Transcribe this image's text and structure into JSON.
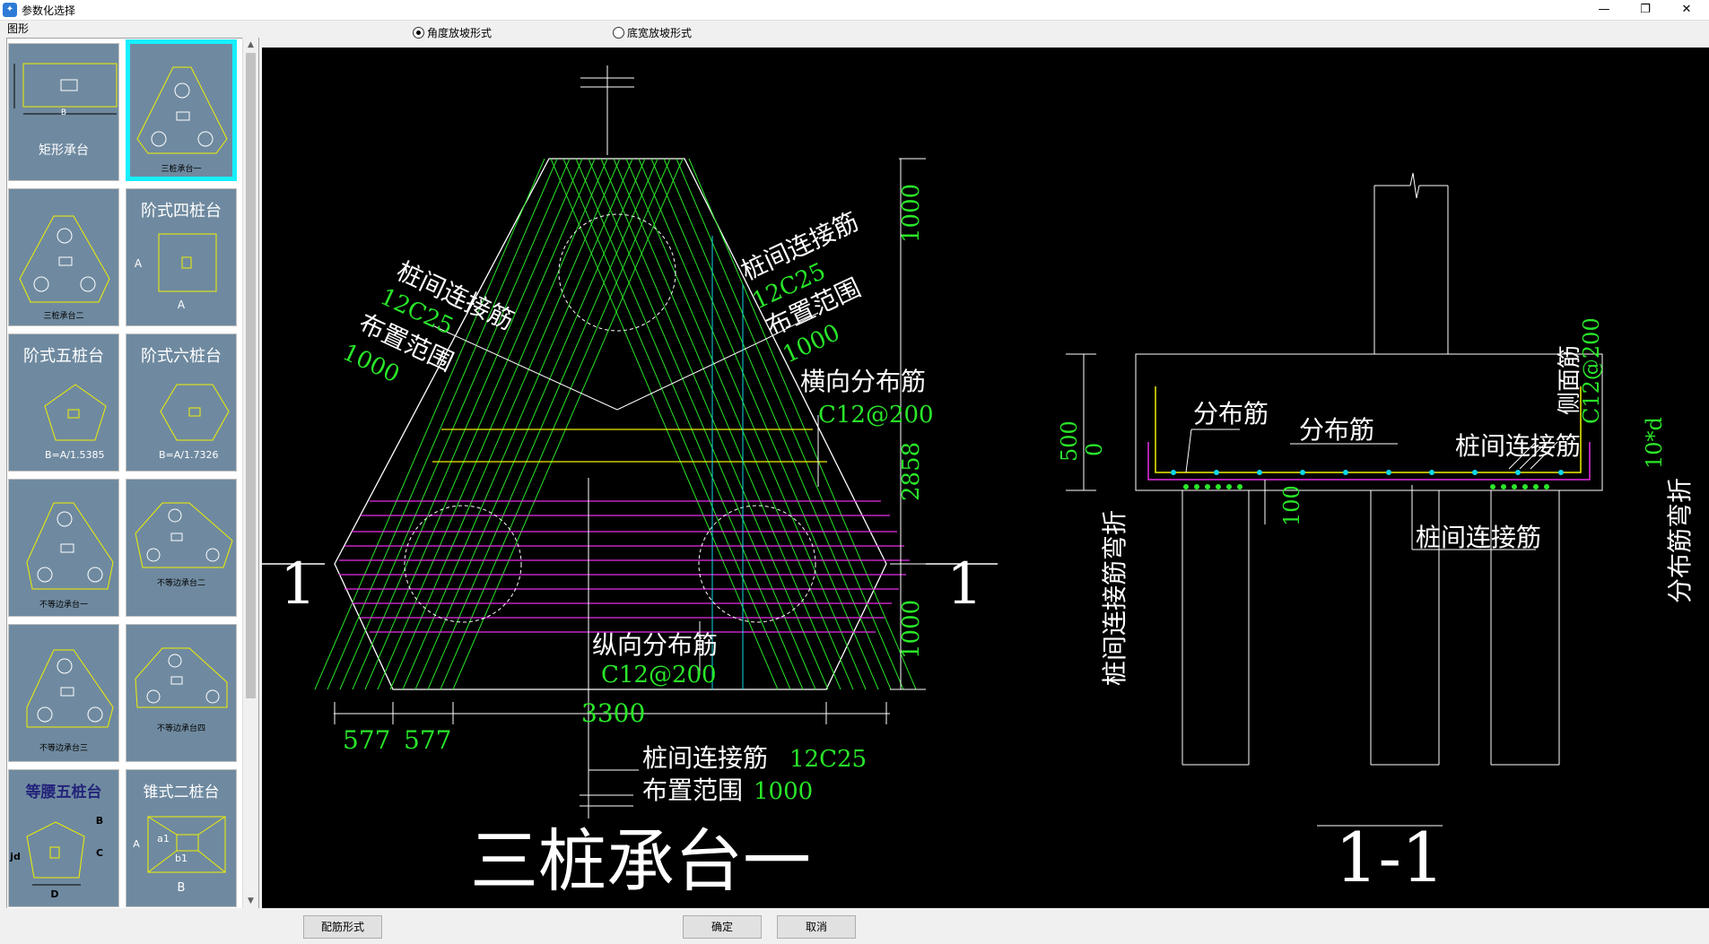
{
  "window": {
    "title": "参数化选择",
    "icon": "app-logo-icon",
    "controls": {
      "minimize": "—",
      "restore": "❐",
      "close": "✕"
    }
  },
  "left": {
    "group_label": "图形",
    "thumbnails": [
      {
        "label": "矩形承台",
        "selected": false
      },
      {
        "label": "三桩承台一",
        "selected": true
      },
      {
        "label": "三桩承台二",
        "selected": false
      },
      {
        "label": "阶式四桩台",
        "selected": false
      },
      {
        "label": "阶式五桩台",
        "selected": false
      },
      {
        "label": "阶式六桩台",
        "selected": false
      },
      {
        "label": "不等边承台一",
        "selected": false
      },
      {
        "label": "不等边承台二",
        "selected": false
      },
      {
        "label": "不等边承台三",
        "selected": false
      },
      {
        "label": "不等边承台四",
        "selected": false
      },
      {
        "label": "等腰五桩台",
        "selected": false
      },
      {
        "label": "锥式二桩台",
        "selected": false
      }
    ],
    "thumb_texts": {
      "b": "B",
      "a": "A",
      "eq5": "B=A/1.5385",
      "eq6": "B=A/1.7326",
      "c": "C",
      "jd": "jd",
      "d": "D",
      "a1": "a1",
      "b1": "b1"
    }
  },
  "options": {
    "radio1": "角度放坡形式",
    "radio2": "底宽放坡形式",
    "selected": "radio1"
  },
  "drawing": {
    "plan": {
      "l1_title": "桩间连接筋",
      "l1_bar": "12C25",
      "l1_range": "布置范围",
      "l1_val": "1000",
      "r1_title": "桩间连接筋",
      "r1_bar": "12C25",
      "r1_range": "布置范围",
      "r1_val": "1000",
      "trans_title": "横向分布筋",
      "trans_bar": "C12@200",
      "dim_top": "1000",
      "dim_mid": "2858",
      "dim_bot": "1000",
      "long_title": "纵向分布筋",
      "long_bar": "C12@200",
      "dim_577a": "577",
      "dim_577b": "577",
      "dim_3300": "3300",
      "bottom_title": "桩间连接筋",
      "bottom_bar": "12C25",
      "bottom_range": "布置范围",
      "bottom_val": "1000",
      "section_left": "1",
      "section_right": "1",
      "main_title": "三桩承台一"
    },
    "section": {
      "dist1": "分布筋",
      "dist2": "分布筋",
      "link": "桩间连接筋",
      "side_title": "侧面筋",
      "side_bar": "C12@200",
      "dim_500": "500",
      "dim_0": "0",
      "dim_100": "100",
      "bent_left": "桩间连接筋弯折",
      "bent_right": "分布筋弯折",
      "bent_val": "10*d",
      "link_bottom": "桩间连接筋",
      "title": "1-1"
    },
    "colors": {
      "rebar": "#29e629",
      "magenta": "#e82ee8",
      "yellow": "#f0f000",
      "cyan": "#10d8e8",
      "canvas": "#000000"
    }
  },
  "buttons": {
    "rebar_form": "配筋形式",
    "ok": "确定",
    "cancel": "取消"
  }
}
